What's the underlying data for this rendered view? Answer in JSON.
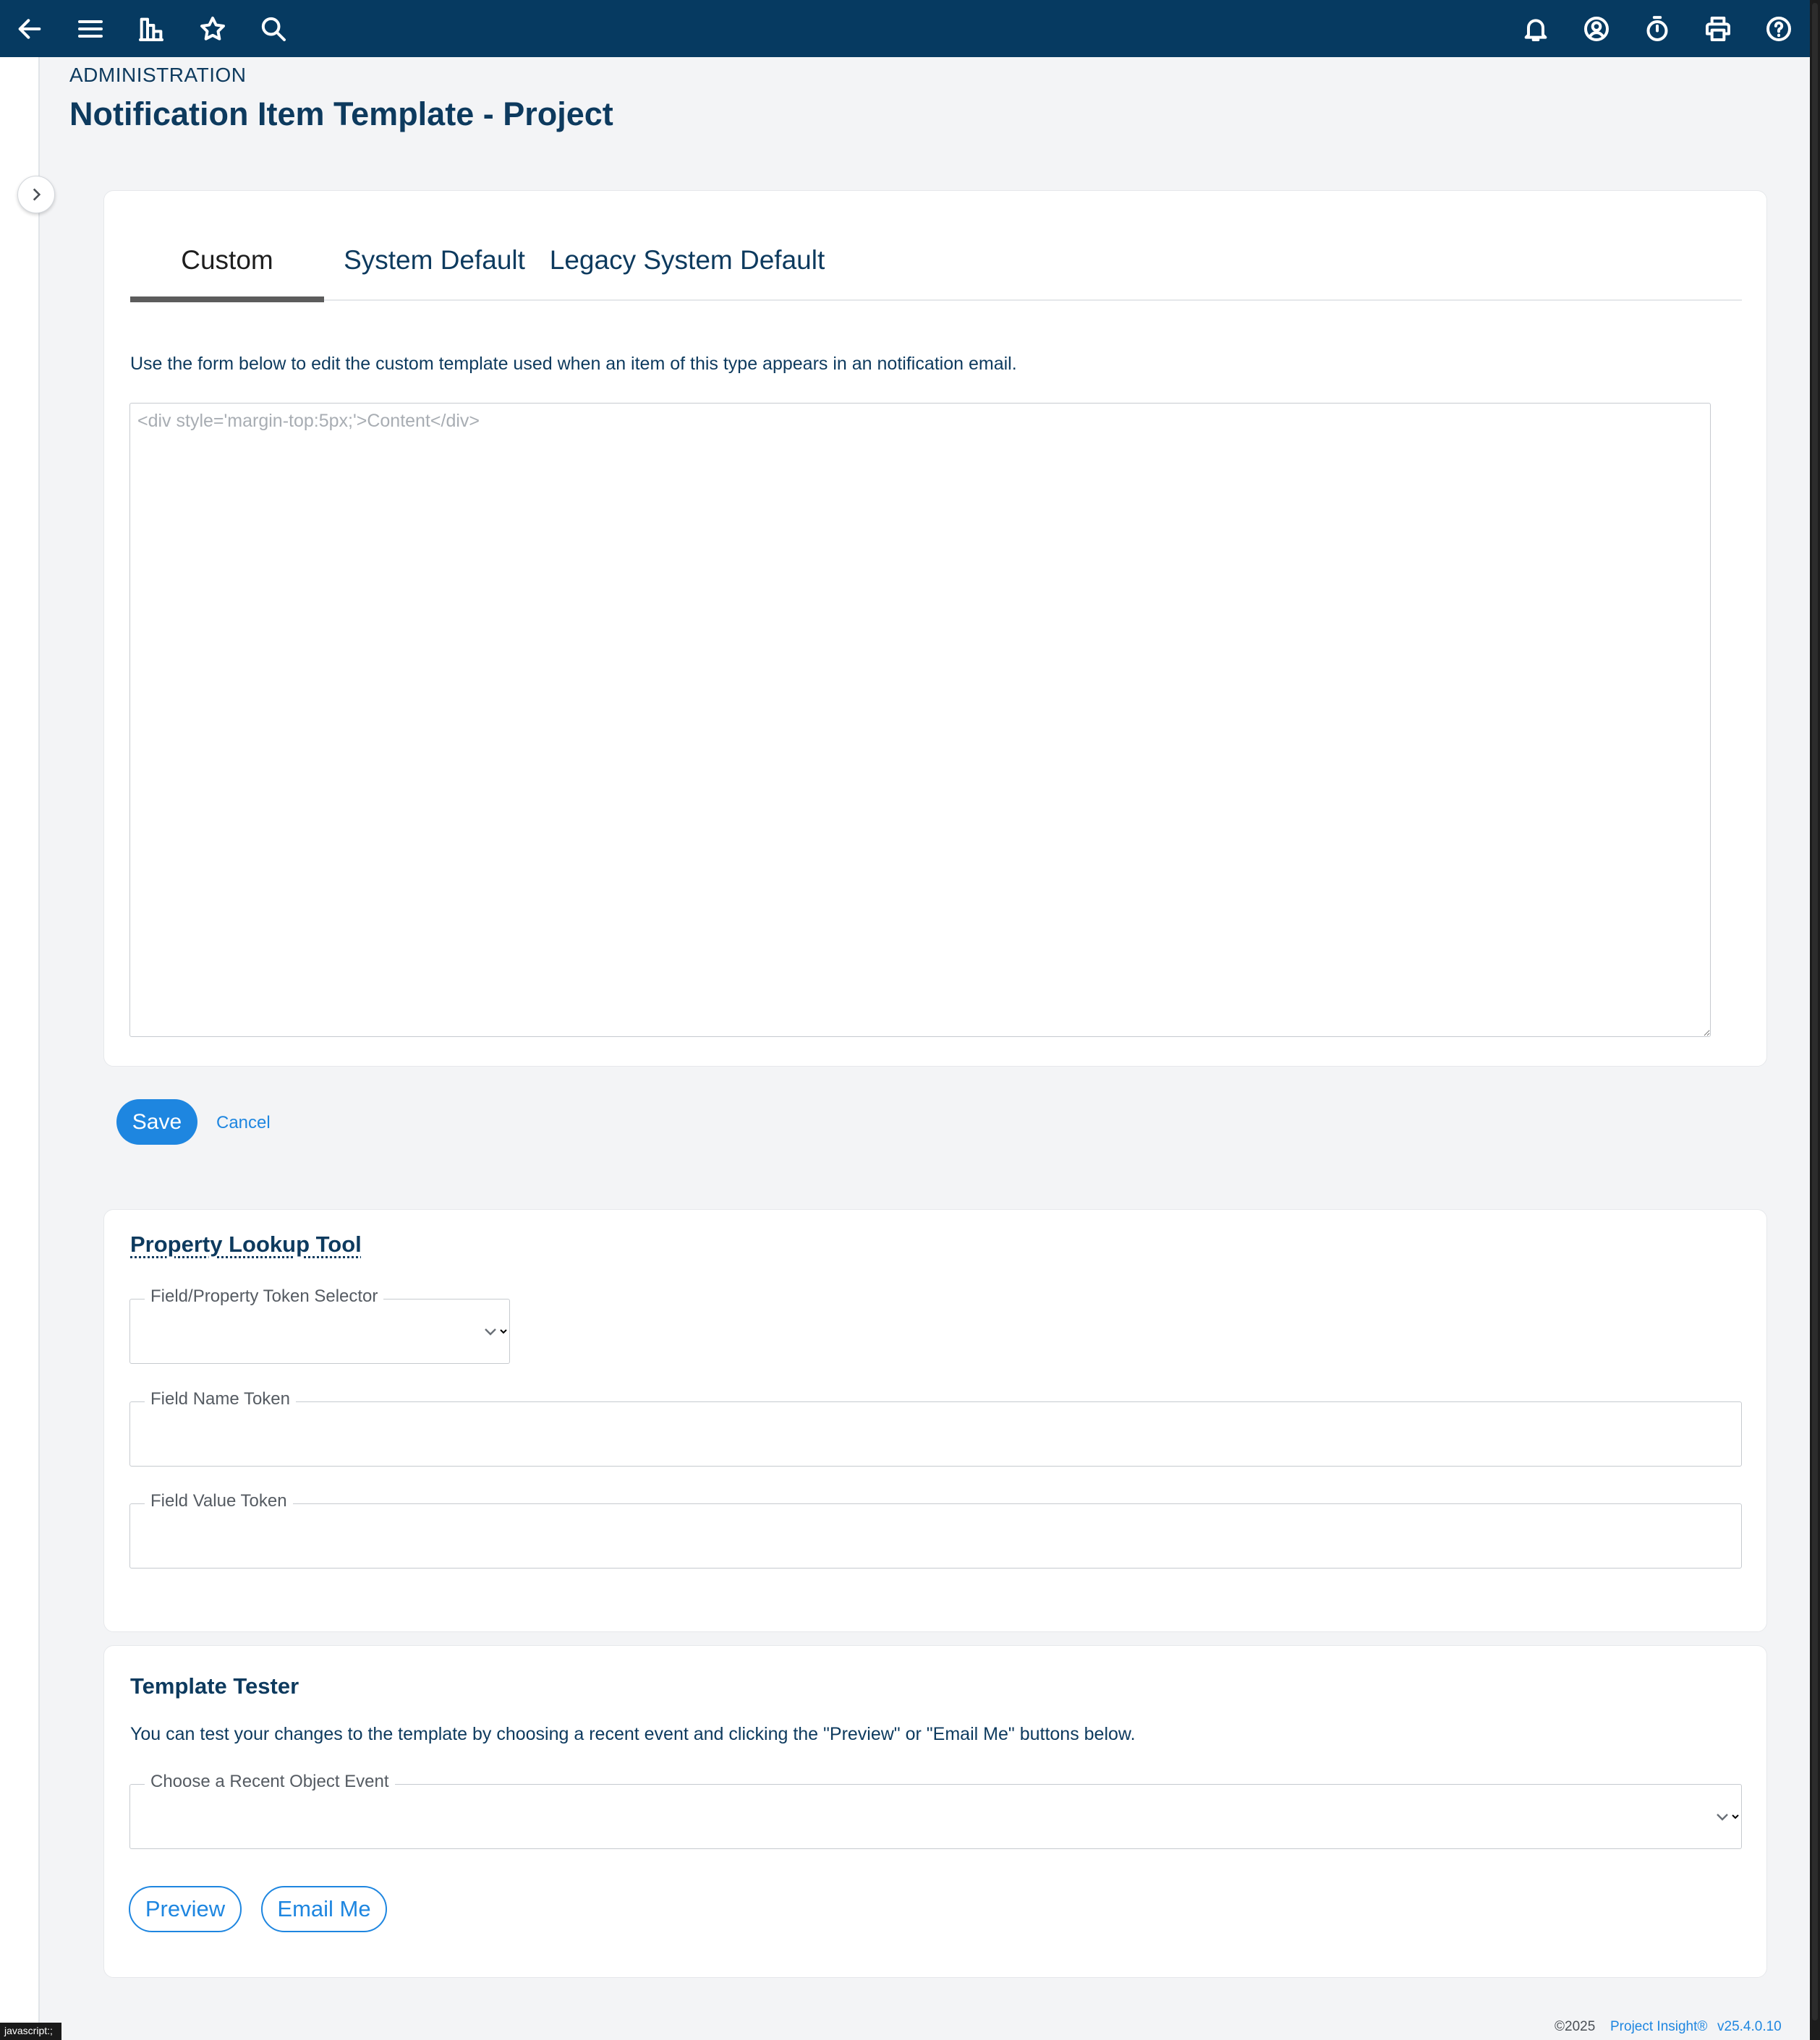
{
  "topbar": {
    "icons": [
      "back-arrow-icon",
      "menu-icon",
      "dashboard-icon",
      "star-icon",
      "search-icon",
      "bell-icon",
      "user-icon",
      "timer-icon",
      "printer-icon",
      "help-icon"
    ]
  },
  "header": {
    "eyebrow": "ADMINISTRATION",
    "title": "Notification Item Template - Project"
  },
  "tabs": [
    {
      "label": "Custom",
      "active": true
    },
    {
      "label": "System Default",
      "active": false
    },
    {
      "label": "Legacy System Default",
      "active": false
    }
  ],
  "editor": {
    "intro": "Use the form below to edit the custom template used when an item of this type appears in an notification email.",
    "placeholder": "<div style='margin-top:5px;'>Content</div>"
  },
  "actions": {
    "save_label": "Save",
    "cancel_label": "Cancel"
  },
  "lookup": {
    "title": "Property Lookup Tool",
    "selector_label": "Field/Property Token Selector",
    "name_label": "Field Name Token",
    "value_label": "Field Value Token"
  },
  "tester": {
    "title": "Template Tester",
    "description": "You can test your changes to the template by choosing a recent event and clicking the \"Preview\" or \"Email Me\" buttons below.",
    "event_label": "Choose a Recent Object Event",
    "preview_label": "Preview",
    "email_label": "Email Me"
  },
  "footer": {
    "copyright": "©2025",
    "product": "Project Insight®",
    "version": "v25.4.0.10"
  },
  "status_bar": "javascript:;",
  "colors": {
    "topbar": "#063a61",
    "accent": "#1e86e0",
    "text": "#0d3a5e"
  }
}
